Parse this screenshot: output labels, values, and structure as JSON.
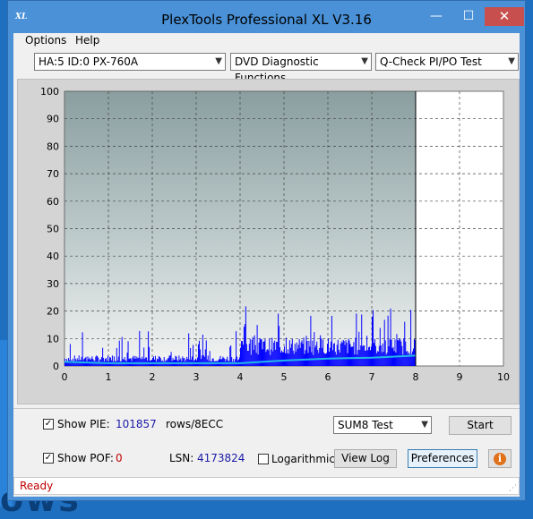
{
  "window": {
    "title": "PlexTools Professional XL V3.16",
    "icon_text": "XL",
    "minimize": "—",
    "maximize": "☐",
    "close": "✕"
  },
  "menu": {
    "options": "Options",
    "help": "Help"
  },
  "toolbar": {
    "drive": "HA:5 ID:0  PX-760A",
    "function": "DVD Diagnostic Functions",
    "test": "Q-Check PI/PO Test"
  },
  "chart_data": {
    "type": "bar",
    "x_range": [
      0,
      10
    ],
    "y_range": [
      0,
      100
    ],
    "x_ticks": [
      "0",
      "1",
      "2",
      "3",
      "4",
      "5",
      "6",
      "7",
      "8",
      "9",
      "10"
    ],
    "y_ticks": [
      "0",
      "10",
      "20",
      "30",
      "40",
      "50",
      "60",
      "70",
      "80",
      "90",
      "100"
    ],
    "grid": true,
    "scan_end_x": 8.0,
    "colors": {
      "bars": "#0000ff",
      "line": "#20b8e8",
      "bg_top": "#8a9ea0",
      "bg_bottom": "#f4f4f4"
    },
    "series": [
      {
        "segment": "0-4",
        "baseline_level": 3,
        "spike_max": 13
      },
      {
        "segment": "4-8",
        "baseline_level": 8,
        "spike_max": 22
      }
    ],
    "line_points": [
      [
        0,
        1.5
      ],
      [
        1,
        1
      ],
      [
        2,
        1
      ],
      [
        3,
        1
      ],
      [
        4,
        1
      ],
      [
        5,
        2
      ],
      [
        6,
        2.7
      ],
      [
        7,
        3
      ],
      [
        8,
        3.8
      ]
    ]
  },
  "options": {
    "show_pie_label": "Show PIE:",
    "pie_value": "101857",
    "pie_unit": "rows/8ECC",
    "show_poe_label": "Show POF:",
    "poe_value": "0",
    "lsn_label": "LSN:",
    "lsn_value": "4173824",
    "logarithmic_label": "Logarithmic",
    "sum_select": "SUM8 Test",
    "start_button": "Start",
    "view_log_button": "View Log",
    "preferences_button": "Preferences",
    "info_button": "i",
    "check": "✓"
  },
  "status": {
    "text": "Ready"
  },
  "desktop": {
    "text": "ows"
  }
}
